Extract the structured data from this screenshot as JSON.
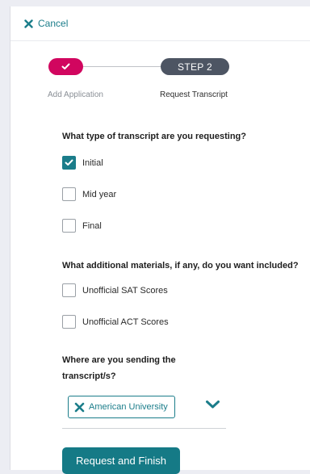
{
  "header": {
    "cancel_label": "Cancel"
  },
  "stepper": {
    "steps": [
      {
        "label": "Add Application",
        "status": "complete"
      },
      {
        "label": "Request Transcript",
        "status": "current",
        "badge": "STEP 2"
      }
    ]
  },
  "transcript_type": {
    "question": "What type of transcript are you requesting?",
    "options": [
      {
        "label": "Initial",
        "checked": true
      },
      {
        "label": "Mid year",
        "checked": false
      },
      {
        "label": "Final",
        "checked": false
      }
    ]
  },
  "additional_materials": {
    "question": "What additional materials, if any, do you want included?",
    "options": [
      {
        "label": "Unofficial SAT Scores",
        "checked": false
      },
      {
        "label": "Unofficial ACT Scores",
        "checked": false
      }
    ]
  },
  "destination": {
    "question": "Where are you sending the transcript/s?",
    "selected": [
      "American University"
    ]
  },
  "actions": {
    "submit_label": "Request and Finish"
  },
  "colors": {
    "accent": "#1b7d8a",
    "step_complete": "#d1065f",
    "step_current": "#4d5563"
  },
  "icons": {
    "cancel": "close-icon",
    "step_done": "check-icon",
    "checkbox_checked": "check-icon",
    "chip_remove": "close-icon",
    "dropdown": "chevron-down-icon"
  }
}
